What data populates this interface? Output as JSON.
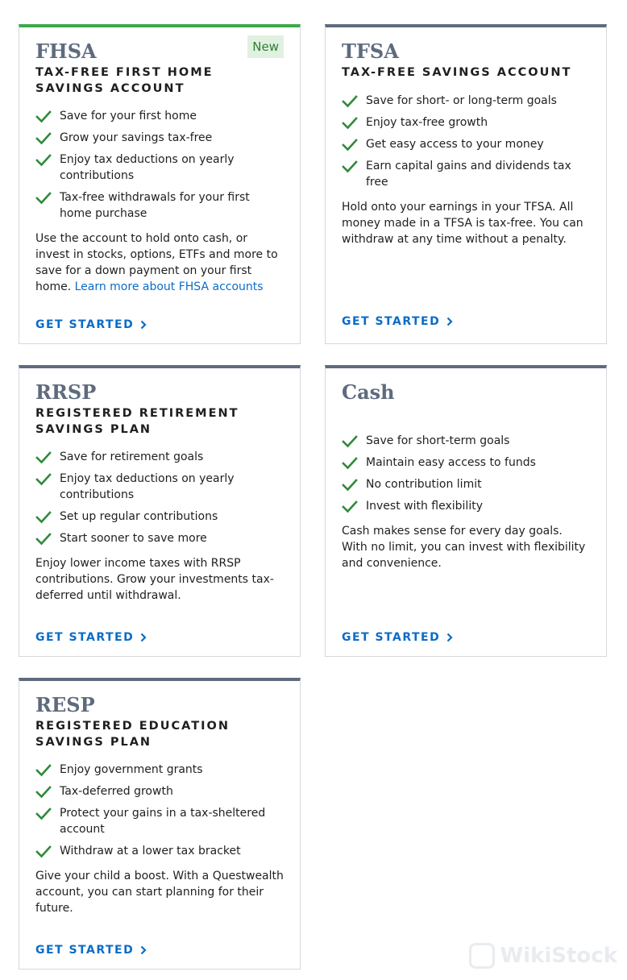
{
  "cards": [
    {
      "abbr": "FHSA",
      "badge": "New",
      "title": "TAX-FREE FIRST HOME SAVINGS ACCOUNT",
      "features": [
        "Save for your first home",
        "Grow your savings tax-free",
        "Enjoy tax deductions on yearly contributions",
        "Tax-free withdrawals for your first home purchase"
      ],
      "description": "Use the account to hold onto cash, or invest in stocks, options, ETFs and more to save for a down payment on your first home.",
      "link": "Learn more about FHSA accounts",
      "cta": "GET STARTED"
    },
    {
      "abbr": "TFSA",
      "title": "TAX-FREE SAVINGS ACCOUNT",
      "features": [
        "Save for short- or long-term goals",
        "Enjoy tax-free growth",
        "Get easy access to your money",
        "Earn capital gains and dividends tax free"
      ],
      "description": "Hold onto your earnings in your TFSA. All money made in a TFSA is tax-free. You can withdraw at any time without a penalty.",
      "cta": "GET STARTED"
    },
    {
      "abbr": "RRSP",
      "title": "REGISTERED RETIREMENT SAVINGS PLAN",
      "features": [
        "Save for retirement goals",
        "Enjoy tax deductions on yearly contributions",
        "Set up regular contributions",
        "Start sooner to save more"
      ],
      "description": "Enjoy lower income taxes with RRSP contributions. Grow your investments tax-deferred until withdrawal.",
      "cta": "GET STARTED"
    },
    {
      "abbr": "Cash",
      "title": "",
      "features": [
        "Save for short-term goals",
        "Maintain easy access to funds",
        "No contribution limit",
        "Invest with flexibility"
      ],
      "description": "Cash makes sense for every day goals. With no limit, you can invest with flexibility and convenience.",
      "cta": "GET STARTED"
    },
    {
      "abbr": "RESP",
      "title": "REGISTERED EDUCATION SAVINGS PLAN",
      "features": [
        "Enjoy government grants",
        "Tax-deferred growth",
        "Protect your gains in a tax-sheltered account",
        "Withdraw at a lower tax bracket"
      ],
      "description": "Give your child a boost. With a Questwealth account, you can start planning for their future.",
      "cta": "GET STARTED"
    }
  ],
  "watermark": "WikiStock",
  "colors": {
    "accent_green": "#3ea84a",
    "header_gray": "#5f6b7d",
    "link_blue": "#0b6cc7",
    "check_green": "#2f8a3a"
  },
  "icons": {
    "feature_bullet": "check-icon",
    "cta_arrow": "chevron-right-icon"
  }
}
